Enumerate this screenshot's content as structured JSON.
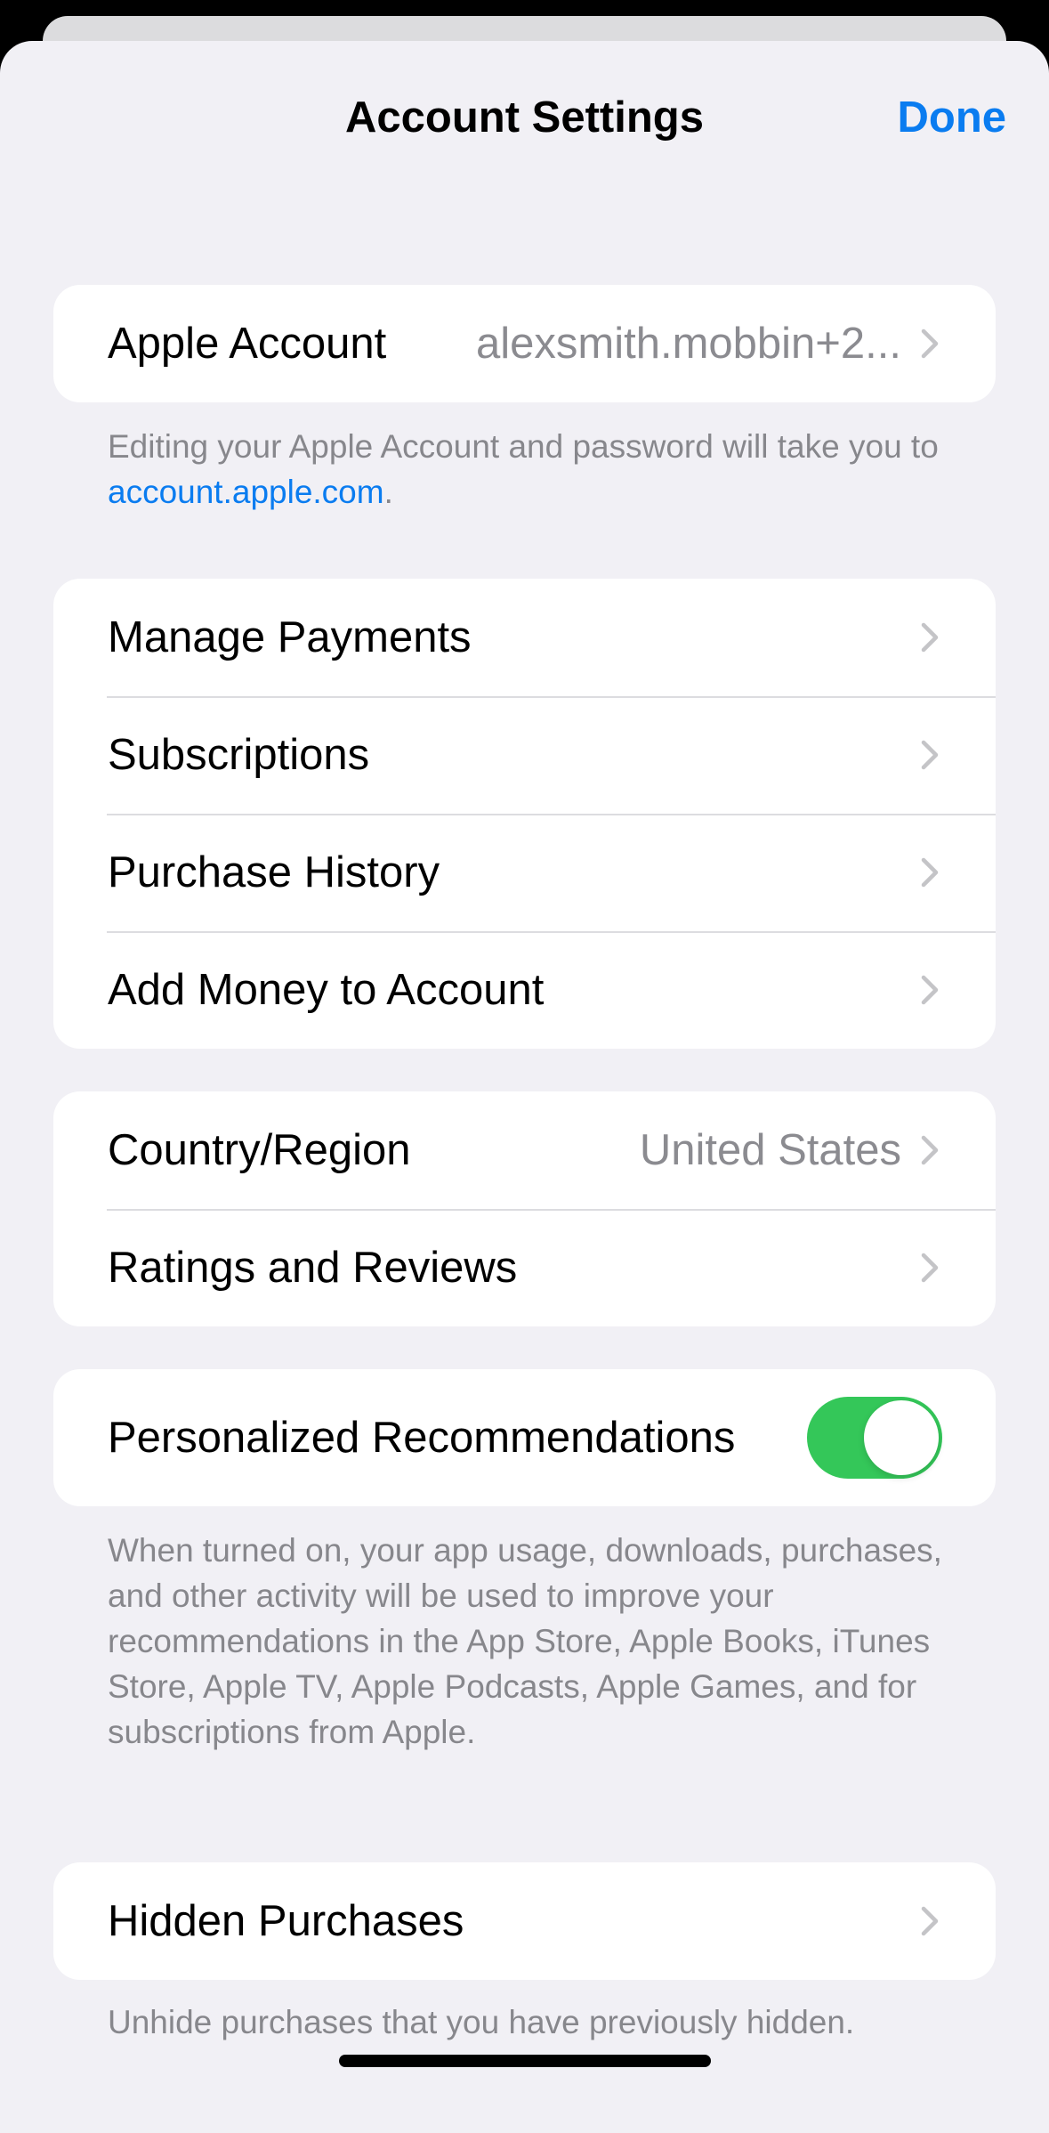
{
  "header": {
    "title": "Account Settings",
    "done_label": "Done"
  },
  "account": {
    "label": "Apple Account",
    "value": "alexsmith.mobbin+2...",
    "footnote_prefix": "Editing your Apple Account and password will take you to ",
    "footnote_link": "account.apple.com",
    "footnote_suffix": "."
  },
  "payments": {
    "items": [
      {
        "label": "Manage Payments"
      },
      {
        "label": "Subscriptions"
      },
      {
        "label": "Purchase History"
      },
      {
        "label": "Add Money to Account"
      }
    ]
  },
  "region": {
    "country_label": "Country/Region",
    "country_value": "United States",
    "ratings_label": "Ratings and Reviews"
  },
  "recommendations": {
    "label": "Personalized Recommendations",
    "enabled": true,
    "footnote": "When turned on, your app usage, downloads, purchases, and other activity will be used to improve your recommendations in the App Store, Apple Books, iTunes Store, Apple TV, Apple Podcasts, Apple Games, and for subscriptions from Apple."
  },
  "hidden": {
    "label": "Hidden Purchases",
    "footnote": "Unhide purchases that you have previously hidden."
  },
  "colors": {
    "accent": "#0a7cf0",
    "toggle_on": "#34c759",
    "background": "#f1f0f5"
  }
}
